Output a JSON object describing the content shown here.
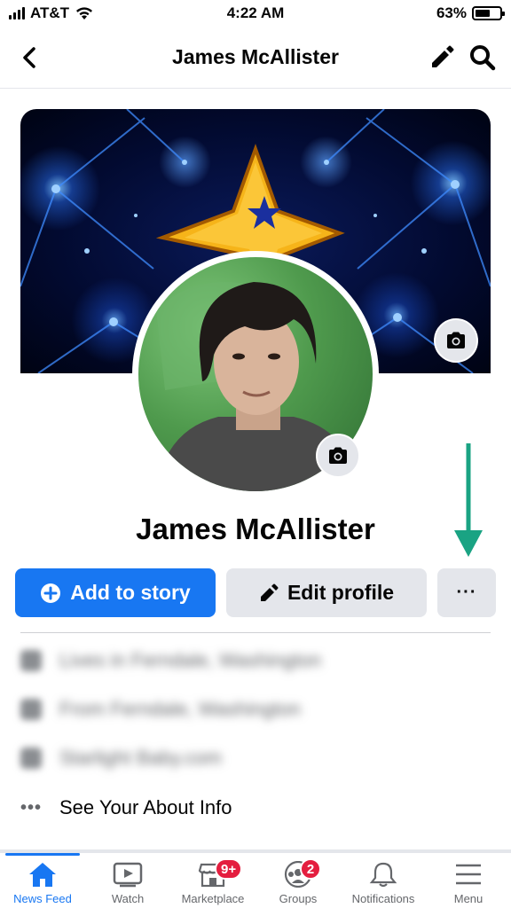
{
  "status_bar": {
    "carrier": "AT&T",
    "time": "4:22 AM",
    "battery_percent": "63%",
    "battery_level": 0.63
  },
  "header": {
    "title": "James McAllister",
    "back_icon": "chevron-left-icon",
    "edit_icon": "pencil-icon",
    "search_icon": "search-icon"
  },
  "profile": {
    "name": "James McAllister"
  },
  "actions": {
    "add_story_label": "Add to story",
    "edit_profile_label": "Edit profile",
    "more_label": "···"
  },
  "about": {
    "items": [
      {
        "icon": "home-icon",
        "text": "Lives in Ferndale, Washington"
      },
      {
        "icon": "location-icon",
        "text": "From Ferndale, Washington"
      },
      {
        "icon": "link-icon",
        "text": "Starlight Baby.com"
      }
    ],
    "see_about_label": "See Your About Info",
    "see_about_icon": "more-dots-icon"
  },
  "tabbar": {
    "tabs": [
      {
        "label": "News Feed",
        "icon": "home-icon",
        "active": true
      },
      {
        "label": "Watch",
        "icon": "play-icon",
        "active": false
      },
      {
        "label": "Marketplace",
        "icon": "shop-icon",
        "active": false,
        "badge": "9+"
      },
      {
        "label": "Groups",
        "icon": "groups-icon",
        "active": false,
        "badge": "2"
      },
      {
        "label": "Notifications",
        "icon": "bell-icon",
        "active": false
      },
      {
        "label": "Menu",
        "icon": "hamburger-icon",
        "active": false
      }
    ]
  },
  "colors": {
    "brand_blue": "#1877f2",
    "button_gray": "#e4e6eb",
    "badge_red": "#e41e3f",
    "annotation_arrow": "#1aa383"
  }
}
